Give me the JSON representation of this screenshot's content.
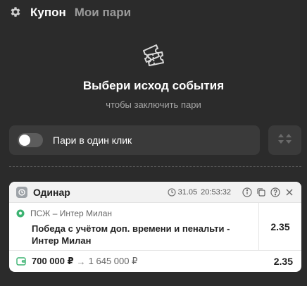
{
  "header": {
    "tabs": [
      {
        "label": "Купон"
      },
      {
        "label": "Мои пари"
      }
    ]
  },
  "empty_state": {
    "title": "Выбери исход события",
    "subtitle": "чтобы заключить пари"
  },
  "one_click": {
    "label": "Пари в один клик",
    "enabled": false
  },
  "coupon": {
    "type": "Одинар",
    "date": "31.05",
    "time": "20:53:32",
    "event": "ПСЖ – Интер Милан",
    "outcome": "Победа с учётом доп. времени и пенальти - Интер Милан",
    "odd": "2.35",
    "stake": "700 000 ₽",
    "arrow": "→",
    "payout": "1 645 000 ₽",
    "total_odd": "2.35"
  },
  "colors": {
    "background": "#2b2b2b",
    "panel": "#3a3a3a",
    "card": "#ffffff",
    "accent_green": "#3cb371"
  }
}
